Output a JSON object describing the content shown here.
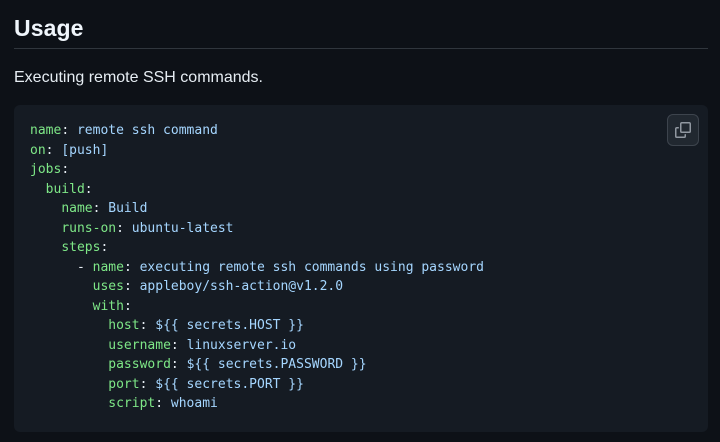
{
  "heading": "Usage",
  "description": "Executing remote SSH commands.",
  "copy_button": {
    "icon": "copy-icon"
  },
  "colors": {
    "background": "#0d1117",
    "code_background": "#151b23",
    "yaml_key": "#7ee787",
    "yaml_value": "#a5d6ff",
    "text": "#e6edf3"
  },
  "code_lines": [
    {
      "indent": "",
      "dash": "",
      "key": "name",
      "value": "remote ssh command"
    },
    {
      "indent": "",
      "dash": "",
      "key": "on",
      "value": "[push]"
    },
    {
      "indent": "",
      "dash": "",
      "key": "jobs",
      "value": ""
    },
    {
      "indent": "  ",
      "dash": "",
      "key": "build",
      "value": ""
    },
    {
      "indent": "    ",
      "dash": "",
      "key": "name",
      "value": "Build"
    },
    {
      "indent": "    ",
      "dash": "",
      "key": "runs-on",
      "value": "ubuntu-latest"
    },
    {
      "indent": "    ",
      "dash": "",
      "key": "steps",
      "value": ""
    },
    {
      "indent": "      ",
      "dash": "- ",
      "key": "name",
      "value": "executing remote ssh commands using password"
    },
    {
      "indent": "        ",
      "dash": "",
      "key": "uses",
      "value": "appleboy/ssh-action@v1.2.0"
    },
    {
      "indent": "        ",
      "dash": "",
      "key": "with",
      "value": ""
    },
    {
      "indent": "          ",
      "dash": "",
      "key": "host",
      "value": "${{ secrets.HOST }}"
    },
    {
      "indent": "          ",
      "dash": "",
      "key": "username",
      "value": "linuxserver.io"
    },
    {
      "indent": "          ",
      "dash": "",
      "key": "password",
      "value": "${{ secrets.PASSWORD }}"
    },
    {
      "indent": "          ",
      "dash": "",
      "key": "port",
      "value": "${{ secrets.PORT }}"
    },
    {
      "indent": "          ",
      "dash": "",
      "key": "script",
      "value": "whoami"
    }
  ]
}
